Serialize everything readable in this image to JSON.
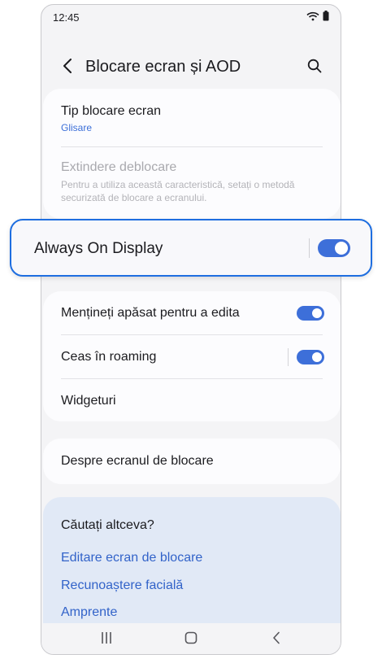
{
  "status_bar": {
    "time": "12:45"
  },
  "header": {
    "title": "Blocare ecran și AOD"
  },
  "lock_card": {
    "lock_type_label": "Tip blocare ecran",
    "lock_type_value": "Glisare",
    "extend_unlock_label": "Extindere deblocare",
    "extend_unlock_desc": "Pentru a utiliza această caracteristică, setați o metodă securizată de blocare a ecranului."
  },
  "highlighted": {
    "label": "Always On Display",
    "toggle_on": true
  },
  "options": {
    "hold_to_edit_label": "Mențineți apăsat pentru a edita",
    "hold_to_edit_on": true,
    "roaming_clock_label": "Ceas în roaming",
    "roaming_clock_on": true,
    "widgets_label": "Widgeturi"
  },
  "about": {
    "label": "Despre ecranul de blocare"
  },
  "suggestions": {
    "heading": "Căutați altceva?",
    "links": [
      "Editare ecran de blocare",
      "Recunoaștere facială",
      "Amprente"
    ]
  },
  "colors": {
    "accent": "#3d6fd9",
    "highlight_border": "#1e6ee0",
    "suggestion_bg": "#e1e9f6"
  },
  "icons": [
    "wifi-icon",
    "battery-icon",
    "back-arrow-icon",
    "search-icon",
    "recents-icon",
    "home-icon",
    "nav-back-icon"
  ]
}
